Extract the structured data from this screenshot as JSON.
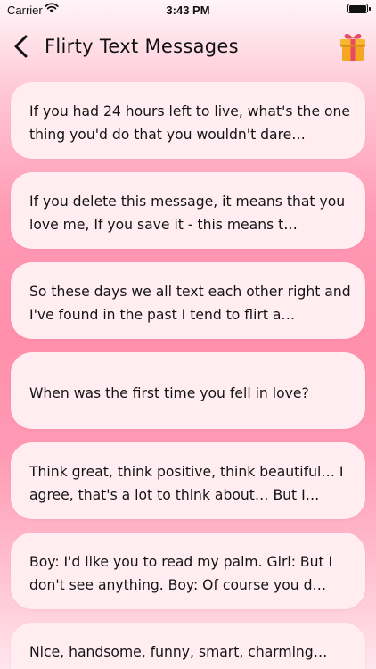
{
  "status_bar": {
    "carrier": "Carrier",
    "time": "3:43 PM"
  },
  "nav": {
    "title": "Flirty Text Messages",
    "back_icon": "chevron-left-icon",
    "gift_icon": "gift-icon"
  },
  "messages": [
    {
      "text": "If you had 24 hours left to live, what's the one thing you'd do that you wouldn't dare…"
    },
    {
      "text": "If you delete this message, it means that you love me, If you save it - this means t…"
    },
    {
      "text": "So these days we all text each other right and I've found in the past I tend to flirt a…"
    },
    {
      "text": "When was the first time you fell in love?"
    },
    {
      "text": "Think great, think positive, think beautiful… I agree, that's a lot to think about… But I…"
    },
    {
      "text": "Boy: I'd like you to read my palm. Girl: But I don't see anything. Boy: Of course you d…"
    },
    {
      "text": "Nice, handsome, funny, smart, charming… Well, enough about me, now about all the…"
    }
  ],
  "colors": {
    "card_background": "#ffedf2",
    "gradient_mid": "#ff8fab",
    "gift_box": "#f7b731",
    "gift_ribbon": "#e84a5f"
  }
}
